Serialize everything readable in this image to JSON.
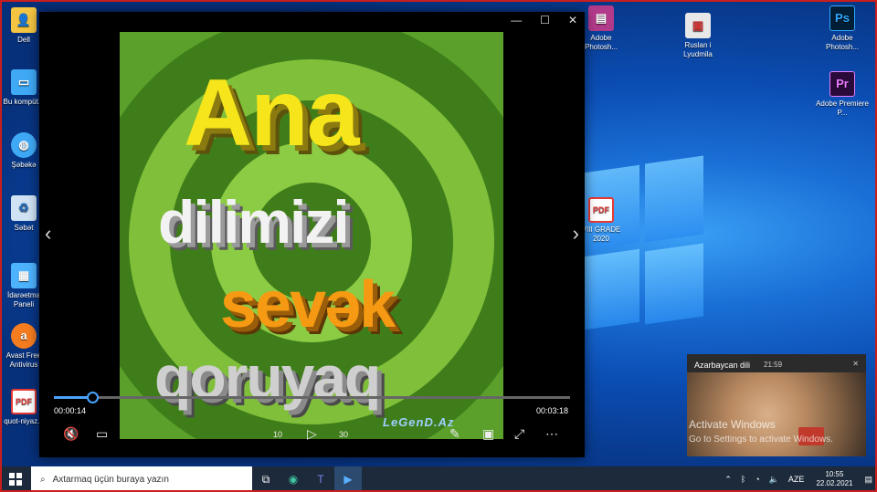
{
  "desktop": {
    "left_icons": [
      {
        "label": "Dell",
        "icon": "user-folder-icon",
        "color": "#f4c542"
      },
      {
        "label": "Bu kompüt...",
        "icon": "computer-icon",
        "color": "#3fa9f5"
      },
      {
        "label": "Şəbəkə",
        "icon": "network-icon",
        "color": "#3fa9f5"
      },
      {
        "label": "Səbət",
        "icon": "recycle-bin-icon",
        "color": "#cfe3f5"
      },
      {
        "label": "İdarəetmə Paneli",
        "icon": "control-panel-icon",
        "color": "#4db3ff"
      },
      {
        "label": "Avast Free Antivirus",
        "icon": "avast-icon",
        "color": "#f57c1f"
      },
      {
        "label": "quot-niyaz...",
        "icon": "pdf-icon",
        "color": "#e53935"
      }
    ],
    "right_icons": [
      {
        "label": "Adobe Photosh...",
        "icon": "winrar-icon",
        "color": "#b23a8a"
      },
      {
        "label": "Ruslan i Lyudmila",
        "icon": "video-file-icon",
        "color": "#e8e8e8"
      },
      {
        "label": "Adobe Photosh...",
        "icon": "photoshop-icon",
        "color": "#001e36",
        "glyph": "Ps"
      },
      {
        "label": "Adobe Premiere P...",
        "icon": "premiere-icon",
        "color": "#2a0a3a",
        "glyph": "Pr"
      },
      {
        "label": "VIII GRADE 2020",
        "icon": "pdf-icon",
        "color": "#e53935",
        "glyph": "PDF"
      }
    ],
    "pdf_glyph": "PDF"
  },
  "player": {
    "back_glyph": "←",
    "minimize_glyph": "—",
    "maximize_glyph": "☐",
    "close_glyph": "✕",
    "prev_glyph": "‹",
    "next_glyph": "›",
    "video_text": {
      "line1": "Ana",
      "line2": "dilimizi",
      "line3": "sevək",
      "line4": "qoruyaq",
      "logo": "LeGenD.Az"
    },
    "current_time": "00:00:14",
    "total_time": "00:03:18",
    "progress": 0.074,
    "controls": {
      "mute": "🔇",
      "subtitles": "▭",
      "rewind": "10",
      "play": "▷",
      "forward": "30",
      "edit": "✎",
      "miniview": "▣",
      "fullscreen": "⤢",
      "more": "⋯"
    }
  },
  "toast": {
    "title": "Azarbaycan dili",
    "time": "21:59",
    "close": "✕"
  },
  "watermark": {
    "line1": "Activate Windows",
    "line2": "Go to Settings to activate Windows."
  },
  "taskbar": {
    "search_placeholder": "Axtarmaq üçün buraya yazın",
    "language": "AZE",
    "time": "10:55",
    "date": "22.02.2021",
    "tray_chevron": "⌃"
  },
  "colors": {
    "frame": "#c81e1e",
    "accent": "#4aa3ff",
    "taskbar": "#1c2a3b"
  }
}
